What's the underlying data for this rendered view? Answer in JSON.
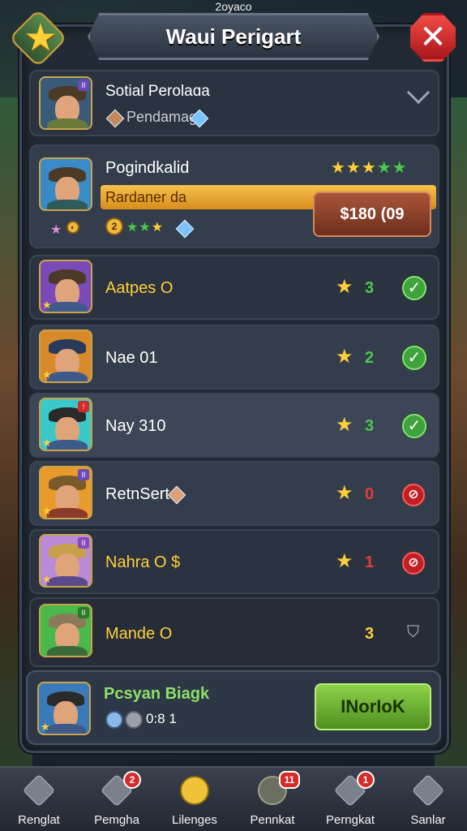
{
  "top_caption": "2oyaco",
  "header": {
    "title": "Waui Perigart"
  },
  "top_row": {
    "name": "Sotial Perolaɑa",
    "sub": "Pendamag"
  },
  "featured": {
    "name": "Pogindkalid",
    "bar_label": "Rardaner da",
    "price": "$180 (09",
    "coin_value": "2"
  },
  "rows": [
    {
      "name": "Aatpes O",
      "count": "3",
      "status": "check"
    },
    {
      "name": "Nae 01",
      "count": "2",
      "status": "check"
    },
    {
      "name": "Nay 310",
      "count": "3",
      "status": "check"
    },
    {
      "name": "RetnSert",
      "count": "0",
      "status": "no"
    },
    {
      "name": "Nahra O $",
      "count": "1",
      "status": "no"
    },
    {
      "name": "Mande O",
      "count": "3",
      "status": "shield"
    }
  ],
  "footer": {
    "name": "Pcsyan Biagk",
    "stats": "0:8 1",
    "button": "INorIoK"
  },
  "nav": [
    {
      "label": "Renglat",
      "badge": ""
    },
    {
      "label": "Pemgha",
      "badge": "2"
    },
    {
      "label": "Lilenges",
      "badge": ""
    },
    {
      "label": "Pennkat",
      "badge": "11"
    },
    {
      "label": "Perngkat",
      "badge": "1"
    },
    {
      "label": "Sanlar",
      "badge": ""
    }
  ],
  "colors": {
    "gold": "#ffcf3a",
    "green": "#3fa23c",
    "red": "#c21f24",
    "panel": "#222a35"
  }
}
